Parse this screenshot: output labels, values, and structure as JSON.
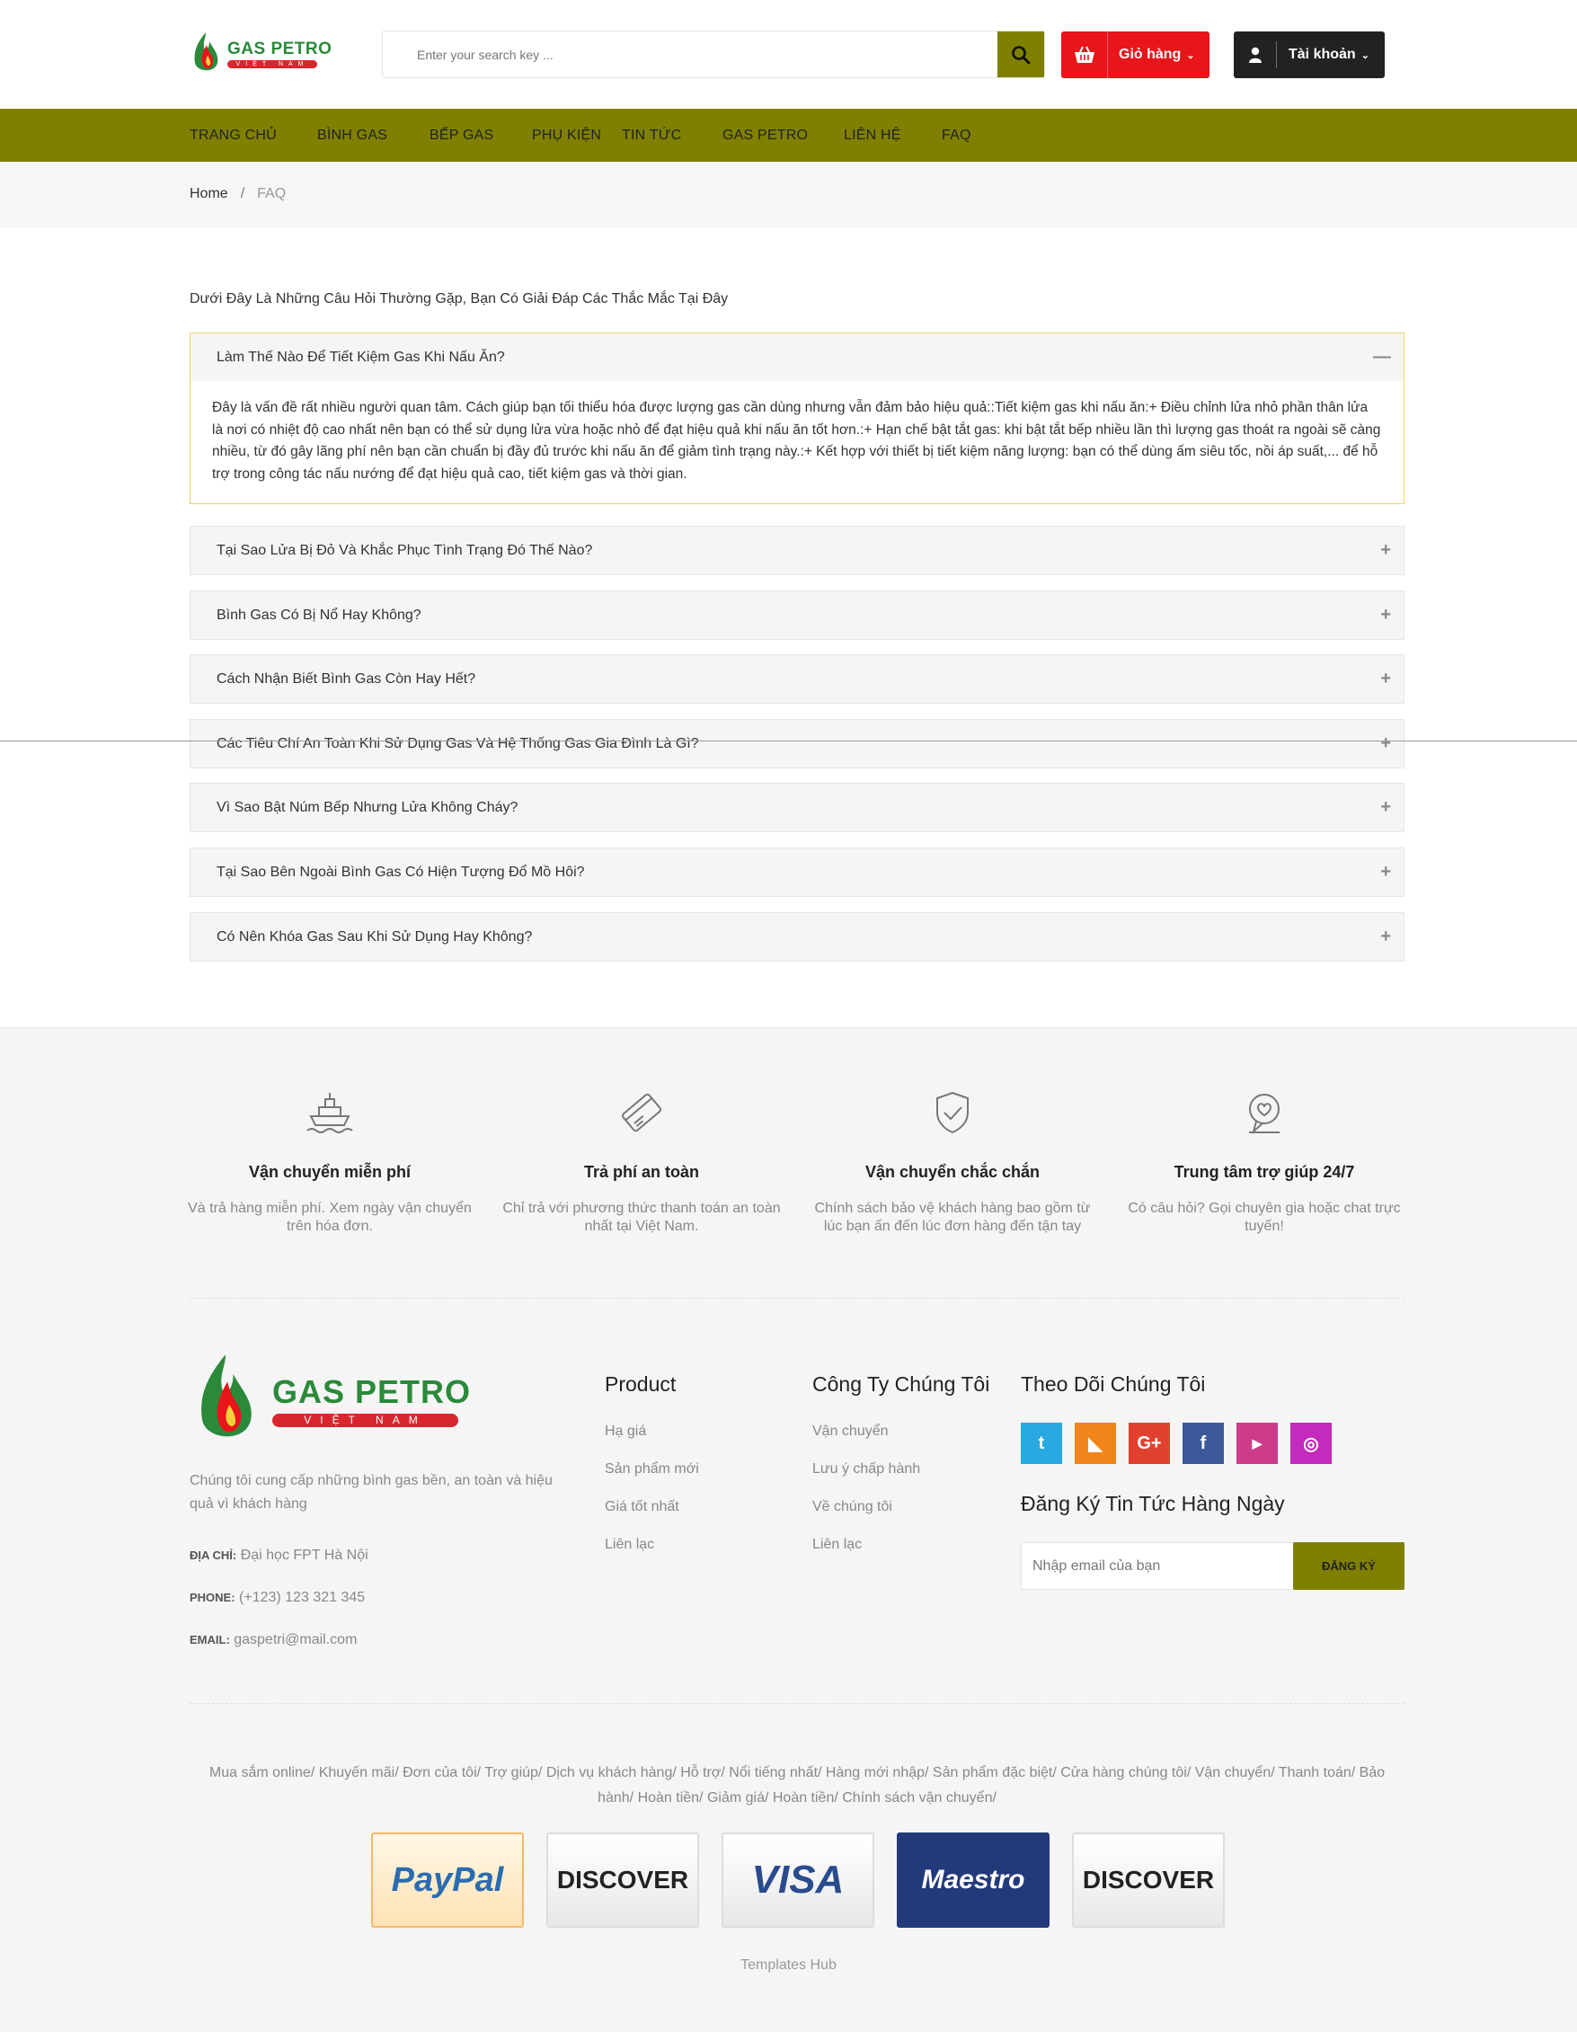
{
  "header": {
    "logo": {
      "brand": "GAS PETRO",
      "sub": "VIỆT NAM"
    },
    "search": {
      "placeholder": "Enter your search key ..."
    },
    "cart_label": "Giỏ hàng",
    "account_label": "Tài khoản"
  },
  "nav": [
    "TRANG CHỦ",
    "BÌNH GAS",
    "BẾP GAS",
    "PHỤ KIỆN",
    "TIN TỨC",
    "GAS PETRO",
    "LIÊN HỆ",
    "FAQ"
  ],
  "breadcrumb": {
    "home": "Home",
    "separator": "/",
    "current": "FAQ"
  },
  "faq": {
    "intro": "Dưới Đây Là Những Câu Hỏi Thường Gặp, Bạn Có Giải Đáp Các Thắc Mắc Tại Đây",
    "items": [
      {
        "question": "Làm Thế Nào Để Tiết Kiệm Gas Khi Nấu Ăn?",
        "answer": "Đây là vấn đề rất nhiều người quan tâm. Cách giúp bạn tối thiểu hóa được lượng gas cần dùng nhưng vẫn đảm bảo hiệu quả::Tiết kiệm gas khi nấu ăn:+ Điều chỉnh lửa nhỏ phần thân lửa là nơi có nhiệt độ cao nhất nên bạn có thể sử dụng lửa vừa hoặc nhỏ để đạt hiệu quả khi nấu ăn tốt hơn.:+ Hạn chế bật tắt gas: khi bật tắt bếp nhiều lần thì lượng gas thoát ra ngoài sẽ càng nhiều, từ đó gây lãng phí nên bạn cần chuẩn bị đầy đủ trước khi nấu ăn để giảm tình trạng này.:+ Kết hợp với thiết bị tiết kiệm năng lượng: bạn có thể dùng ấm siêu tốc, nồi áp suất,... để hỗ trợ trong công tác nấu nướng để đạt hiệu quả cao, tiết kiệm gas và thời gian.",
        "open": true
      },
      {
        "question": "Tại Sao Lửa Bị Đỏ Và Khắc Phục Tình Trạng Đó Thế Nào?",
        "open": false
      },
      {
        "question": "Bình Gas Có Bị Nổ Hay Không?",
        "open": false
      },
      {
        "question": "Cách Nhận Biết Bình Gas Còn Hay Hết?",
        "open": false
      },
      {
        "question": "Các Tiêu Chí An Toàn Khi Sử Dụng Gas Và Hệ Thống Gas Gia Đình Là Gì?",
        "open": false
      },
      {
        "question": "Vì Sao Bật Núm Bếp Nhưng Lửa Không Cháy?",
        "open": false
      },
      {
        "question": "Tại Sao Bên Ngoài Bình Gas Có Hiện Tượng Đổ Mồ Hôi?",
        "open": false
      },
      {
        "question": "Có Nên Khóa Gas Sau Khi Sử Dụng Hay Không?",
        "open": false
      }
    ]
  },
  "features": [
    {
      "icon": "ship-icon",
      "title": "Vận chuyển miễn phí",
      "desc": "Và trả hàng miễn phí. Xem ngày vận chuyển trên hóa đơn."
    },
    {
      "icon": "card-icon",
      "title": "Trả phí an toàn",
      "desc": "Chỉ trả với phương thức thanh toán an toàn nhất tại Việt Nam."
    },
    {
      "icon": "shield-check-icon",
      "title": "Vận chuyển chắc chắn",
      "desc": "Chính sách bảo vệ khách hàng bao gồm từ lúc bạn ấn đến lúc đơn hàng đến tận tay"
    },
    {
      "icon": "support-icon",
      "title": "Trung tâm trợ giúp 24/7",
      "desc": "Có câu hỏi? Gọi chuyên gia hoặc chat trực tuyến!"
    }
  ],
  "footer": {
    "logo": {
      "brand": "GAS PETRO",
      "sub": "VIỆT NAM"
    },
    "desc": "Chúng tôi cung cấp những bình gas bền, an toàn và hiệu quả vì khách hàng",
    "address_label": "ĐỊA CHỈ:",
    "address": "Đại học FPT Hà Nội",
    "phone_label": "PHONE:",
    "phone": "(+123) 123 321 345",
    "email_label": "EMAIL:",
    "email": "gaspetri@mail.com",
    "product": {
      "title": "Product",
      "items": [
        "Hạ giá",
        "Sản phẩm mới",
        "Giá tốt nhất",
        "Liên lạc"
      ]
    },
    "company": {
      "title": "Công Ty Chúng Tôi",
      "items": [
        "Vận chuyển",
        "Lưu ý chấp hành",
        "Về chúng tôi",
        "Liên lạc"
      ]
    },
    "follow": {
      "title": "Theo Dõi Chúng Tôi",
      "social": [
        {
          "icon": "twitter-icon",
          "glyph": "t",
          "color": "#29a9e1"
        },
        {
          "icon": "rss-icon",
          "glyph": "◣",
          "color": "#f0861a"
        },
        {
          "icon": "google-plus-icon",
          "glyph": "G+",
          "color": "#e0412f"
        },
        {
          "icon": "facebook-icon",
          "glyph": "f",
          "color": "#3b5998"
        },
        {
          "icon": "youtube-icon",
          "glyph": "▶",
          "color": "#cc3c8b"
        },
        {
          "icon": "instagram-icon",
          "glyph": "◎",
          "color": "#c42bbd"
        }
      ]
    },
    "subscribe": {
      "title": "Đăng Ký Tin Tức Hàng Ngày",
      "placeholder": "Nhập email của bạn",
      "button": "ĐĂNG KÝ"
    },
    "links": "Mua sắm online/ Khuyến mãi/ Đơn của tôi/ Trợ giúp/ Dịch vụ khách hàng/ Hỗ trợ/ Nổi tiếng nhất/ Hàng mới nhập/ Sản phẩm đặc biệt/ Cửa hàng chúng tôi/ Vận chuyển/ Thanh toán/ Bảo hành/ Hoàn tiền/ Giảm giá/ Hoàn tiền/ Chính sách vận chuyển/",
    "payments": [
      "PayPal",
      "DISCOVER",
      "VISA",
      "Maestro",
      "DISCOVER"
    ],
    "copyright": "Templates Hub"
  },
  "colors": {
    "olive": "#7f8000",
    "red": "#e8151b",
    "dark": "#222222"
  }
}
